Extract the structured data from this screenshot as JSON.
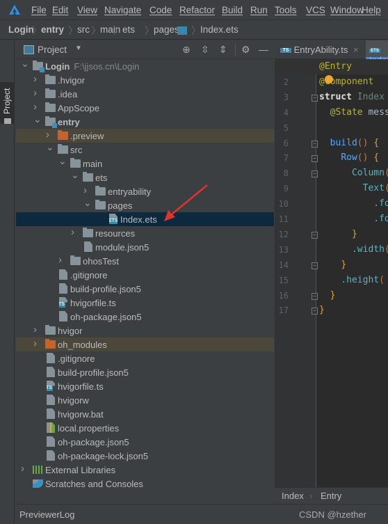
{
  "menubar": {
    "items": [
      "File",
      "Edit",
      "View",
      "Navigate",
      "Code",
      "Refactor",
      "Build",
      "Run",
      "Tools",
      "VCS",
      "Window",
      "Help"
    ]
  },
  "breadcrumb": [
    "Login",
    "entry",
    "src",
    "main",
    "ets",
    "pages",
    "Index.ets"
  ],
  "left_strip": {
    "project_tab": "Project"
  },
  "project_panel": {
    "title": "Project",
    "toolbar_icons": [
      "locate-icon",
      "expand-all-icon",
      "collapse-all-icon",
      "gear-icon",
      "minimize-icon"
    ],
    "tree": [
      {
        "label": "Login",
        "path": "F:\\jjsos.cn\\Login",
        "level": 0,
        "kind": "module",
        "expanded": true,
        "bold": true
      },
      {
        "label": ".hvigor",
        "level": 1,
        "kind": "folder",
        "expanded": false
      },
      {
        "label": ".idea",
        "level": 1,
        "kind": "folder",
        "expanded": false
      },
      {
        "label": "AppScope",
        "level": 1,
        "kind": "folder",
        "expanded": false
      },
      {
        "label": "entry",
        "level": 1,
        "kind": "module",
        "expanded": true,
        "bold": true
      },
      {
        "label": ".preview",
        "level": 2,
        "kind": "excluded",
        "expanded": false,
        "highlight": "excluded"
      },
      {
        "label": "src",
        "level": 2,
        "kind": "folder",
        "expanded": true
      },
      {
        "label": "main",
        "level": 3,
        "kind": "folder",
        "expanded": true
      },
      {
        "label": "ets",
        "level": 4,
        "kind": "folder",
        "expanded": true
      },
      {
        "label": "entryability",
        "level": 5,
        "kind": "folder",
        "expanded": false
      },
      {
        "label": "pages",
        "level": 5,
        "kind": "folder",
        "expanded": true
      },
      {
        "label": "Index.ets",
        "level": 6,
        "kind": "ets",
        "highlight": "selected"
      },
      {
        "label": "resources",
        "level": 4,
        "kind": "folder",
        "expanded": false
      },
      {
        "label": "module.json5",
        "level": 4,
        "kind": "json"
      },
      {
        "label": "ohosTest",
        "level": 3,
        "kind": "folder",
        "expanded": false
      },
      {
        "label": ".gitignore",
        "level": 2,
        "kind": "ignore"
      },
      {
        "label": "build-profile.json5",
        "level": 2,
        "kind": "json"
      },
      {
        "label": "hvigorfile.ts",
        "level": 2,
        "kind": "ts"
      },
      {
        "label": "oh-package.json5",
        "level": 2,
        "kind": "json"
      },
      {
        "label": "hvigor",
        "level": 1,
        "kind": "folder",
        "expanded": false
      },
      {
        "label": "oh_modules",
        "level": 1,
        "kind": "excluded",
        "expanded": false,
        "highlight": "excluded"
      },
      {
        "label": ".gitignore",
        "level": 1,
        "kind": "ignore"
      },
      {
        "label": "build-profile.json5",
        "level": 1,
        "kind": "json"
      },
      {
        "label": "hvigorfile.ts",
        "level": 1,
        "kind": "ts"
      },
      {
        "label": "hvigorw",
        "level": 1,
        "kind": "shell"
      },
      {
        "label": "hvigorw.bat",
        "level": 1,
        "kind": "text"
      },
      {
        "label": "local.properties",
        "level": 1,
        "kind": "properties"
      },
      {
        "label": "oh-package.json5",
        "level": 1,
        "kind": "json"
      },
      {
        "label": "oh-package-lock.json5",
        "level": 1,
        "kind": "json"
      },
      {
        "label": "External Libraries",
        "level": 0,
        "kind": "libraries",
        "expanded": false
      },
      {
        "label": "Scratches and Consoles",
        "level": 0,
        "kind": "scratches"
      }
    ]
  },
  "editor": {
    "tabs": [
      {
        "label": "EntryAbility.ts",
        "icon": "TS",
        "active": false
      },
      {
        "label": "Index.ets",
        "icon": "ETS",
        "active": true
      }
    ],
    "lines": [
      [
        [
          "@Entry",
          "annotation"
        ]
      ],
      [
        [
          "@Component",
          "annotation"
        ]
      ],
      [
        [
          "struct ",
          "kw2"
        ],
        [
          "Index",
          "type"
        ]
      ],
      [
        [
          "  "
        ],
        [
          "@State",
          "annotation"
        ],
        [
          " mess",
          "plain"
        ]
      ],
      [],
      [
        [
          "  "
        ],
        [
          "build",
          "fn"
        ],
        [
          "()",
          "paren"
        ],
        [
          " {",
          "brace"
        ]
      ],
      [
        [
          "    "
        ],
        [
          "Row",
          "fn"
        ],
        [
          "()",
          "paren"
        ],
        [
          " {",
          "brace"
        ]
      ],
      [
        [
          "      "
        ],
        [
          "Column",
          "method"
        ],
        [
          "(",
          "paren"
        ]
      ],
      [
        [
          "        "
        ],
        [
          "Text",
          "method"
        ],
        [
          "(",
          "paren"
        ]
      ],
      [
        [
          "          "
        ],
        [
          ".fo",
          "method"
        ]
      ],
      [
        [
          "          "
        ],
        [
          ".fo",
          "method"
        ]
      ],
      [
        [
          "      "
        ],
        [
          "}",
          "brace"
        ]
      ],
      [
        [
          "      "
        ],
        [
          ".width",
          "method"
        ],
        [
          "(",
          "paren"
        ]
      ],
      [
        [
          "    "
        ],
        [
          "}",
          "brace"
        ]
      ],
      [
        [
          "    "
        ],
        [
          ".height",
          "method"
        ],
        [
          "(",
          "paren"
        ]
      ],
      [
        [
          "  "
        ],
        [
          "}",
          "brace"
        ]
      ],
      [
        [
          "}",
          "brace"
        ]
      ]
    ],
    "breadcrumb": [
      "Index",
      "Entry"
    ]
  },
  "status_bar": {
    "tool_window": "PreviewerLog",
    "watermark": "CSDN @hzether"
  },
  "colors": {
    "selected_row": "#0d293e",
    "excluded_row": "#4b473b",
    "annotation_arrow": "#e0332a"
  }
}
